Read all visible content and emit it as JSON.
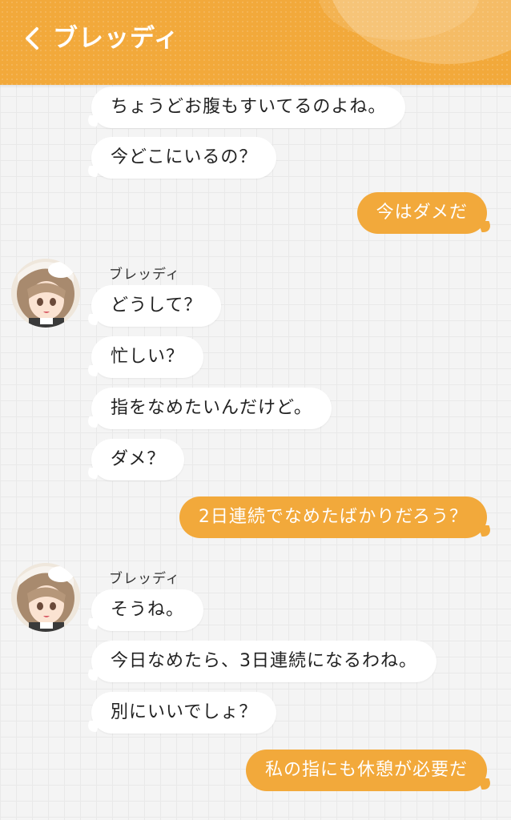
{
  "header": {
    "title": "ブレッディ",
    "back_icon": "chevron-left-icon",
    "color": "#f2a93b"
  },
  "messages": [
    {
      "from": "other",
      "text": "ちょうどお腹もすいてるのよね。"
    },
    {
      "from": "other",
      "text": "今どこにいるの？"
    },
    {
      "from": "me",
      "text": "今はダメだ"
    },
    {
      "from": "other",
      "sender": "ブレッディ",
      "text": "どうして？"
    },
    {
      "from": "other",
      "text": "忙しい？"
    },
    {
      "from": "other",
      "text": "指をなめたいんだけど。"
    },
    {
      "from": "other",
      "text": "ダメ？"
    },
    {
      "from": "me",
      "text": "2日連続でなめたばかりだろう？"
    },
    {
      "from": "other",
      "sender": "ブレッディ",
      "text": "そうね。"
    },
    {
      "from": "other",
      "text": "今日なめたら、3日連続になるわね。"
    },
    {
      "from": "other",
      "text": "別にいいでしょ？"
    },
    {
      "from": "me",
      "text": "私の指にも休憩が必要だ"
    }
  ],
  "colors": {
    "bubble_me": "#f2a93b",
    "bubble_other": "#ffffff",
    "background": "#f4f4f4"
  }
}
